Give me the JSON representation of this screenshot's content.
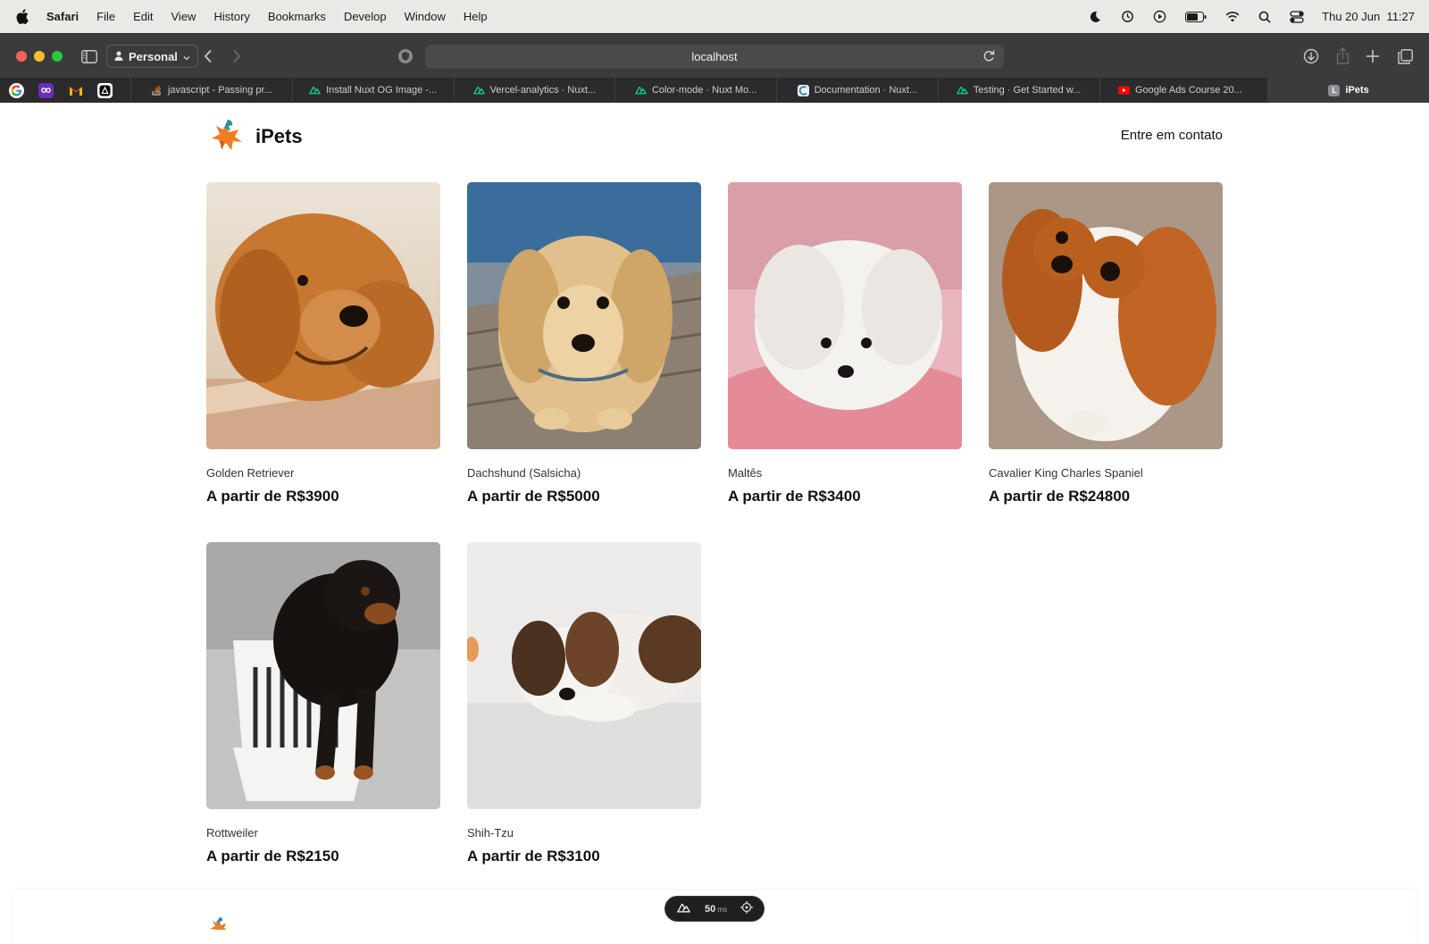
{
  "menubar": {
    "app": "Safari",
    "items": [
      "File",
      "Edit",
      "View",
      "History",
      "Bookmarks",
      "Develop",
      "Window",
      "Help"
    ],
    "clock": "Thu 20 Jun  11:27",
    "status_icons": [
      "moon-icon",
      "time-machine-icon",
      "play-icon",
      "battery-icon",
      "wifi-icon",
      "search-icon",
      "control-center-icon"
    ]
  },
  "toolbar": {
    "profile": "Personal",
    "url": "localhost"
  },
  "tabs": {
    "pinned": [
      "google-icon",
      "bookmark-app-icon",
      "gmail-icon",
      "vercel-icon"
    ],
    "items": [
      {
        "label": "javascript - Passing pr...",
        "icon": "stackoverflow-icon"
      },
      {
        "label": "Install Nuxt OG Image -...",
        "icon": "nuxt-icon"
      },
      {
        "label": "Vercel-analytics · Nuxt...",
        "icon": "nuxt-icon"
      },
      {
        "label": "Color-mode · Nuxt Mo...",
        "icon": "nuxt-icon"
      },
      {
        "label": "Documentation · Nuxt...",
        "icon": "docs-icon"
      },
      {
        "label": "Testing · Get Started w...",
        "icon": "nuxt-icon"
      },
      {
        "label": "Google Ads Course 20...",
        "icon": "youtube-icon"
      }
    ],
    "active": {
      "label": "iPets",
      "icon": "L"
    }
  },
  "site": {
    "brand": "iPets",
    "contact": "Entre em contato"
  },
  "pets": [
    {
      "breed": "Golden Retriever",
      "price": "A partir de R$3900"
    },
    {
      "breed": "Dachshund (Salsicha)",
      "price": "A partir de R$5000"
    },
    {
      "breed": "Maltês",
      "price": "A partir de R$3400"
    },
    {
      "breed": "Cavalier King Charles Spaniel",
      "price": "A partir de R$24800"
    },
    {
      "breed": "Rottweiler",
      "price": "A partir de R$2150"
    },
    {
      "breed": "Shih-Tzu",
      "price": "A partir de R$3100"
    }
  ],
  "devtools": {
    "time": "50",
    "unit": "ms"
  },
  "colors": {
    "accent_orange": "#ef7d22",
    "accent_teal": "#2a8fa0"
  }
}
